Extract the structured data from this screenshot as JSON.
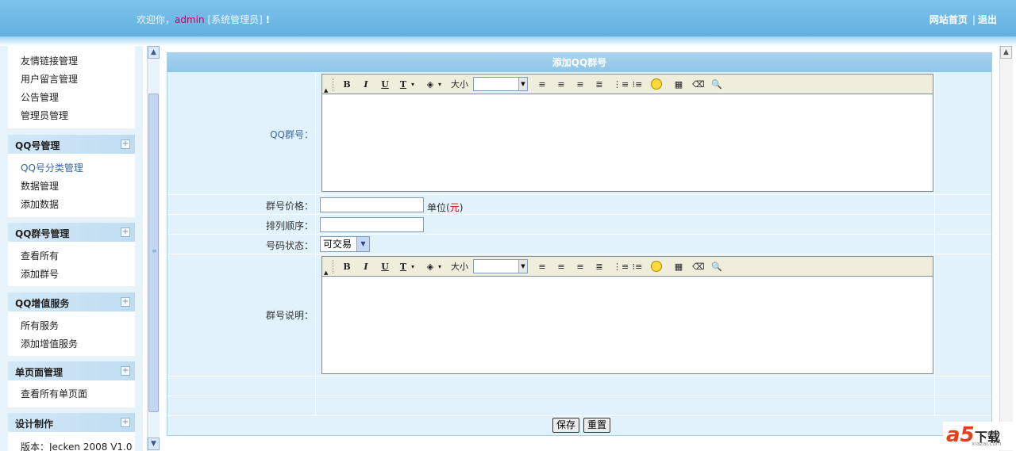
{
  "header": {
    "welcome_prefix": "欢迎你，",
    "username": "admin",
    "role": "[系统管理员]",
    "exclaim": "!",
    "home_link": "网站首页",
    "separator": "|",
    "logout_link": "退出"
  },
  "sidebar": {
    "group0_items": [
      "友情链接管理",
      "用户留言管理",
      "公告管理",
      "管理员管理"
    ],
    "groups": [
      {
        "title": "QQ号管理",
        "items": [
          "QQ号分类管理",
          "数据管理",
          "添加数据"
        ]
      },
      {
        "title": "QQ群号管理",
        "items": [
          "查看所有",
          "添加群号"
        ]
      },
      {
        "title": "QQ增值服务",
        "items": [
          "所有服务",
          "添加增值服务"
        ]
      },
      {
        "title": "单页面管理",
        "items": [
          "查看所有单页面"
        ]
      },
      {
        "title": "设计制作",
        "items": [
          "版本：Jecken 2008 V1.0"
        ]
      }
    ],
    "expand_glyph": "+"
  },
  "form": {
    "title": "添加QQ群号",
    "qq_label": "QQ群号：",
    "price_label": "群号价格：",
    "price_value": "",
    "unit_prefix": "单位(",
    "unit_currency": "元",
    "unit_suffix": ")",
    "order_label": "排列顺序：",
    "order_value": "",
    "status_label": "号码状态：",
    "status_value": "可交易",
    "desc_label": "群号说明：",
    "save_button": "保存",
    "reset_button": "重置"
  },
  "editor_toolbar": {
    "bold": "B",
    "italic": "I",
    "underline": "U",
    "font_color": "T",
    "size_label": "大小",
    "size_value": "",
    "dropdown_glyph": "▾"
  },
  "watermark": {
    "logo": "a5",
    "text": "下载",
    "sub": "xiazai.com"
  },
  "colors": {
    "header": "#6fbbe7",
    "panel": "#e2f2fb",
    "title_bar": "#9bccea",
    "accent_user": "#c8005a",
    "currency": "#cc0000"
  }
}
